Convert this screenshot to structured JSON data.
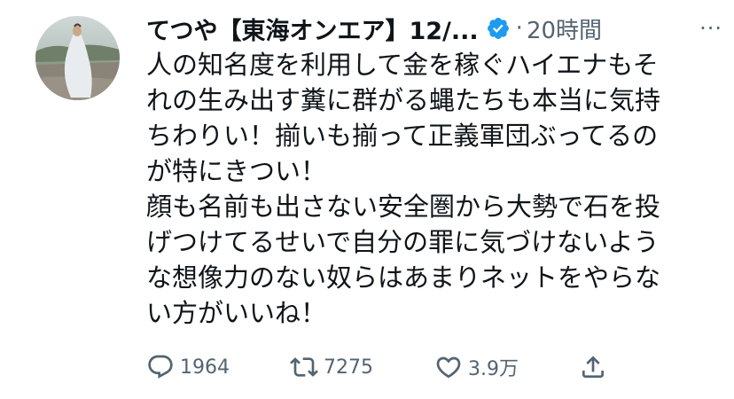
{
  "tweet": {
    "author_name": "てつや【東海オンエア】12/...",
    "separator": "·",
    "time": "20時間",
    "more_label": "···",
    "body_lines": [
      "人の知名度を利用して金を稼ぐハイエナもそ",
      "れの生み出す糞に群がる蝿たちも本当に気持",
      "ちわりい！揃いも揃って正義軍団ぶってるの",
      "が特にきつい！",
      "顔も名前も出さない安全圏から大勢で石を投",
      "げつけてるせいで自分の罪に気づけないよう",
      "な想像力のない奴らはあまりネットをやらな",
      "い方がいいね！"
    ],
    "actions": {
      "replies": "1964",
      "retweets": "7275",
      "likes": "3.9万"
    }
  },
  "colors": {
    "text": "#0f1419",
    "secondary": "#536471",
    "verified": "#1d9bf0",
    "background": "#ffffff"
  },
  "icons": {
    "verified": "verified-badge-icon",
    "reply": "reply-icon",
    "retweet": "retweet-icon",
    "like": "heart-icon",
    "share": "share-icon",
    "more": "more-icon"
  }
}
